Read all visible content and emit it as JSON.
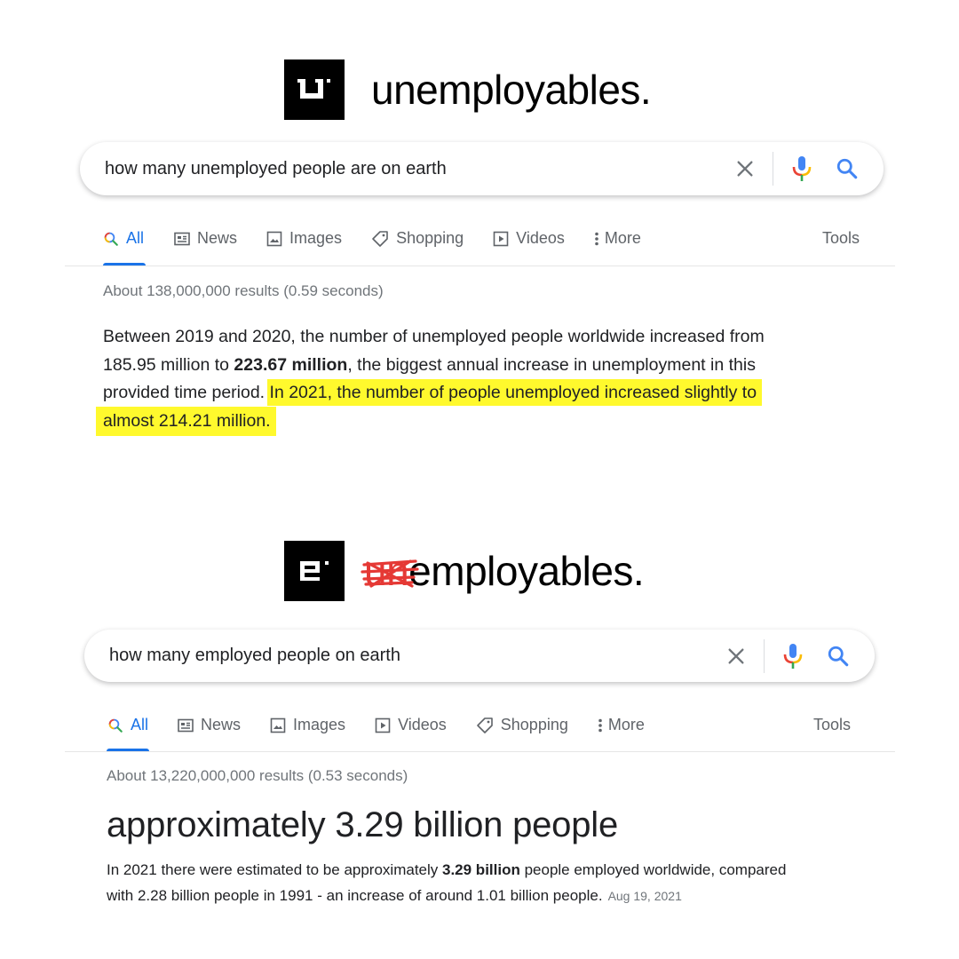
{
  "top": {
    "brand": {
      "logo_letter": "u",
      "word": "unemployables."
    },
    "search": {
      "query": "how many unemployed people are on earth"
    },
    "tabs": [
      {
        "label": "All",
        "icon": "search-icon",
        "active": true
      },
      {
        "label": "News",
        "icon": "news-icon"
      },
      {
        "label": "Images",
        "icon": "image-icon"
      },
      {
        "label": "Shopping",
        "icon": "tag-icon"
      },
      {
        "label": "Videos",
        "icon": "play-icon"
      },
      {
        "label": "More",
        "icon": "dots-vertical-icon"
      }
    ],
    "tools_label": "Tools",
    "result_stats": "About 138,000,000 results (0.59 seconds)",
    "snippet": {
      "line1": "Between 2019 and 2020, the number of unemployed people worldwide increased from",
      "line2_pre": "185.95 million to ",
      "line2_bold": "223.67 million",
      "line2_post": ", the biggest annual increase in unemployment in this",
      "line3_pre": "provided time period. ",
      "highlight_line1": "In 2021, the number of people unemployed increased slightly to",
      "highlight_line2": "almost 214.21 million."
    }
  },
  "bottom": {
    "brand": {
      "logo_letter": "e",
      "struck_prefix": "un",
      "word": "employables."
    },
    "search": {
      "query": "how many employed people on earth"
    },
    "tabs": [
      {
        "label": "All",
        "icon": "search-icon",
        "active": true
      },
      {
        "label": "News",
        "icon": "news-icon"
      },
      {
        "label": "Images",
        "icon": "image-icon"
      },
      {
        "label": "Videos",
        "icon": "play-icon"
      },
      {
        "label": "Shopping",
        "icon": "tag-icon"
      },
      {
        "label": "More",
        "icon": "dots-vertical-icon"
      }
    ],
    "tools_label": "Tools",
    "result_stats": "About 13,220,000,000 results (0.53 seconds)",
    "answer": "approximately 3.29 billion people",
    "snippet": {
      "line1_pre": "In 2021 there were estimated to be approximately ",
      "line1_bold": "3.29 billion",
      "line1_post": " people employed worldwide, compared",
      "line2": "with 2.28 billion people in 1991 - an increase of around 1.01 billion people.",
      "date": "Aug 19, 2021"
    }
  },
  "colors": {
    "google_blue": "#1a73e8",
    "highlight": "#fff92d",
    "strike_red": "#e53935",
    "mic_red": "#ea4335",
    "mic_yellow": "#fbbc04",
    "mic_green": "#34a853"
  }
}
